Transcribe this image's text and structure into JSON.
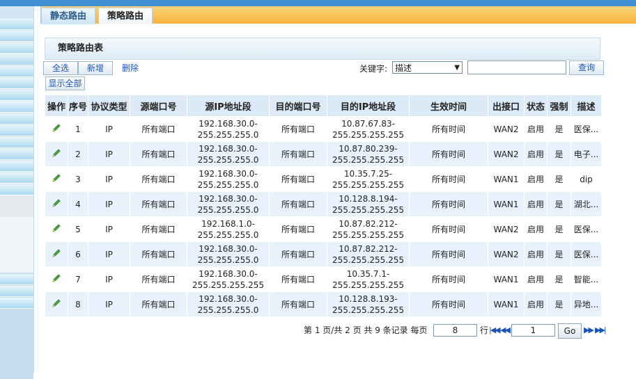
{
  "tabs": [
    {
      "label": "静态路由",
      "active": false
    },
    {
      "label": "策略路由",
      "active": true
    }
  ],
  "panel_title": "策略路由表",
  "toolbar": {
    "select_all": "全选",
    "add": "新增",
    "delete": "删除",
    "show_all": "显示全部",
    "keyword_label": "关键字:",
    "keyword_select": "描述",
    "keyword_value": "",
    "query": "查询"
  },
  "columns": [
    "操作",
    "序号",
    "协议类型",
    "源端口号",
    "源IP地址段",
    "目的端口号",
    "目的IP地址段",
    "生效时间",
    "出接口",
    "状态",
    "强制",
    "描述"
  ],
  "rows": [
    {
      "seq": "1",
      "proto": "IP",
      "src_port": "所有端口",
      "src_ip_1": "192.168.30.0-",
      "src_ip_2": "255.255.255.0",
      "dst_port": "所有端口",
      "dst_ip_1": "10.87.67.83-",
      "dst_ip_2": "255.255.255.255",
      "time": "所有时间",
      "iface": "WAN2",
      "status": "启用",
      "force": "是",
      "desc": "医保..."
    },
    {
      "seq": "2",
      "proto": "IP",
      "src_port": "所有端口",
      "src_ip_1": "192.168.30.0-",
      "src_ip_2": "255.255.255.0",
      "dst_port": "所有端口",
      "dst_ip_1": "10.87.80.239-",
      "dst_ip_2": "255.255.255.255",
      "time": "所有时间",
      "iface": "WAN2",
      "status": "启用",
      "force": "是",
      "desc": "电子..."
    },
    {
      "seq": "3",
      "proto": "IP",
      "src_port": "所有端口",
      "src_ip_1": "192.168.30.0-",
      "src_ip_2": "255.255.255.0",
      "dst_port": "所有端口",
      "dst_ip_1": "10.35.7.25-",
      "dst_ip_2": "255.255.255.255",
      "time": "所有时间",
      "iface": "WAN1",
      "status": "启用",
      "force": "是",
      "desc": "dip"
    },
    {
      "seq": "4",
      "proto": "IP",
      "src_port": "所有端口",
      "src_ip_1": "192.168.30.0-",
      "src_ip_2": "255.255.255.0",
      "dst_port": "所有端口",
      "dst_ip_1": "10.128.8.194-",
      "dst_ip_2": "255.255.255.255",
      "time": "所有时间",
      "iface": "WAN1",
      "status": "启用",
      "force": "是",
      "desc": "湖北..."
    },
    {
      "seq": "5",
      "proto": "IP",
      "src_port": "所有端口",
      "src_ip_1": "192.168.1.0-",
      "src_ip_2": "255.255.255.0",
      "dst_port": "所有端口",
      "dst_ip_1": "10.87.82.212-",
      "dst_ip_2": "255.255.255.255",
      "time": "所有时间",
      "iface": "WAN2",
      "status": "启用",
      "force": "是",
      "desc": "医保..."
    },
    {
      "seq": "6",
      "proto": "IP",
      "src_port": "所有端口",
      "src_ip_1": "192.168.30.0-",
      "src_ip_2": "255.255.255.0",
      "dst_port": "所有端口",
      "dst_ip_1": "10.87.82.212-",
      "dst_ip_2": "255.255.255.255",
      "time": "所有时间",
      "iface": "WAN2",
      "status": "启用",
      "force": "是",
      "desc": "医保..."
    },
    {
      "seq": "7",
      "proto": "IP",
      "src_port": "所有端口",
      "src_ip_1": "192.168.30.0-",
      "src_ip_2": "255.255.255.255",
      "dst_port": "所有端口",
      "dst_ip_1": "10.35.7.1-",
      "dst_ip_2": "255.255.255.255",
      "time": "所有时间",
      "iface": "WAN1",
      "status": "启用",
      "force": "是",
      "desc": "智能..."
    },
    {
      "seq": "8",
      "proto": "IP",
      "src_port": "所有端口",
      "src_ip_1": "192.168.30.0-",
      "src_ip_2": "255.255.255.0",
      "dst_port": "所有端口",
      "dst_ip_1": "10.128.8.193-",
      "dst_ip_2": "255.255.255.255",
      "time": "所有时间",
      "iface": "WAN1",
      "status": "启用",
      "force": "是",
      "desc": "异地..."
    }
  ],
  "pager": {
    "summary": "第 1 页/共 2 页 共 9 条记录 每页",
    "per_page": "8",
    "row_unit": "行",
    "page_value": "1",
    "go": "Go"
  },
  "icons": {
    "edit": "pencil-icon",
    "first": "first-page-icon",
    "prev": "prev-page-icon",
    "next": "next-page-icon",
    "last": "last-page-icon"
  },
  "colors": {
    "tab_bar": "#f7b23b",
    "header_bg": "#dceaf7",
    "row_alt": "#e8f2fc",
    "link": "#1c54b5",
    "edit_icon": "#3a9a2a"
  }
}
